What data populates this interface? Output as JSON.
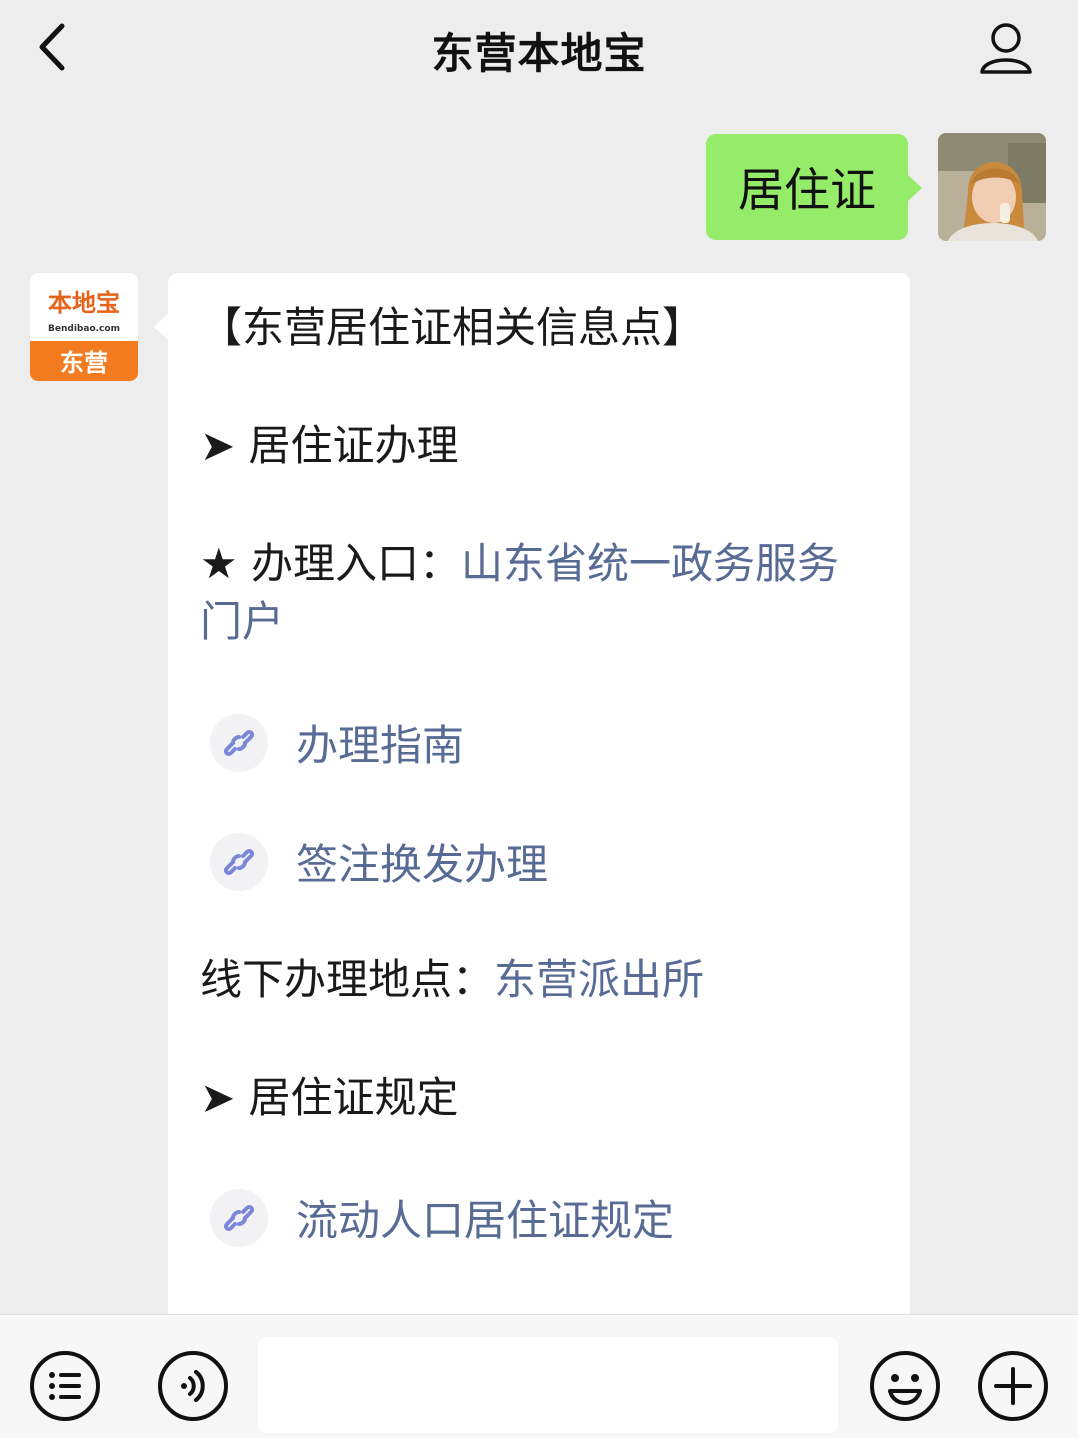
{
  "header": {
    "title": "东营本地宝",
    "back_icon": "chevron-left-icon",
    "profile_icon": "person-icon"
  },
  "outgoing": {
    "text": "居住证",
    "bubble_color": "#95ec69"
  },
  "bot_avatar": {
    "logo_text": "本地宝",
    "logo_sub": "Bendibao.com",
    "city": "东营",
    "brand_color": "#f47a1f"
  },
  "reply": {
    "heading": "【东营居住证相关信息点】",
    "section1": "➤ 居住证办理",
    "entry_prefix": "★ 办理入口：",
    "entry_link_line1": "山东省统一政务服务",
    "entry_link_line2": "门户",
    "mini_programs": [
      {
        "label": "办理指南",
        "icon": "mini-program-link-icon"
      },
      {
        "label": "签注换发办理",
        "icon": "mini-program-link-icon"
      }
    ],
    "offline_prefix": "线下办理地点：",
    "offline_link": "东营派出所",
    "section2": "➤ 居住证规定",
    "mini_programs_2": [
      {
        "label": "流动人口居住证规定",
        "icon": "mini-program-link-icon"
      }
    ],
    "link_color": "#576b95"
  },
  "bottom_bar": {
    "menu_icon": "menu-list-icon",
    "voice_icon": "voice-icon",
    "emoji_icon": "emoji-icon",
    "plus_icon": "plus-icon"
  }
}
